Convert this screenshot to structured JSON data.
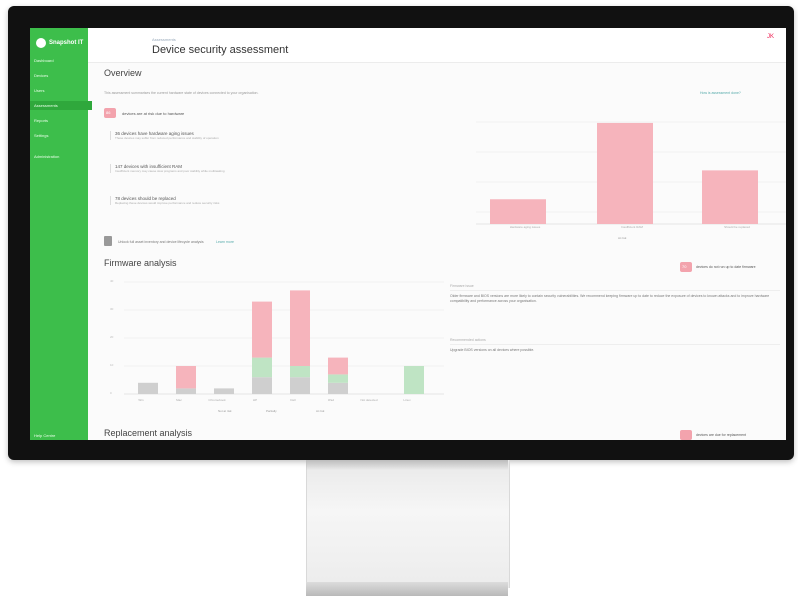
{
  "app": {
    "brand": "Snapshot IT"
  },
  "sidebar": {
    "items": [
      {
        "label": "Dashboard"
      },
      {
        "label": "Devices"
      },
      {
        "label": "Users"
      },
      {
        "label": "Assessments"
      },
      {
        "label": "Reports"
      },
      {
        "label": "Settings"
      },
      {
        "label": "Administration"
      }
    ],
    "footer": "Help Centre"
  },
  "header": {
    "breadcrumb": "Assessments",
    "title": "Device security assessment",
    "user": "JK"
  },
  "overview": {
    "heading": "Overview",
    "intro": "This assessment summarises the current hardware state of devices connected to your organisation.",
    "right_link": "How is assessment done?",
    "badge_value": "86",
    "badge_text": "devices are at risk due to hardware",
    "issues": [
      {
        "title": "36 devices have hardware aging issues",
        "desc": "These devices may suffer from reduced performance and stability of operation"
      },
      {
        "title": "147 devices with insufficient RAM",
        "desc": "Insufficient memory may cause slow programs and poor stability while multitasking"
      },
      {
        "title": "78 devices should be replaced",
        "desc": "Replacing these devices would improve performance and reduce security risks"
      }
    ],
    "footer_text": "Unlock full asset inventory and device lifecycle analysis",
    "footer_link": "Learn more",
    "chart_yticks": [
      "",
      "",
      "",
      "",
      ""
    ],
    "chart_xlabels": [
      "Hardware aging issues",
      "Insufficient RAM",
      "Should be replaced"
    ],
    "chart_legend": "At risk",
    "chart_colors": {
      "risk": "#f6b4bc",
      "ok": "#bfe4c4",
      "neutral": "#cfcfcf"
    }
  },
  "chart_data": [
    {
      "type": "bar",
      "categories": [
        "Hardware aging issues",
        "Insufficient RAM",
        "Should be replaced"
      ],
      "values": [
        36,
        147,
        78
      ],
      "title": "",
      "xlabel": "",
      "ylabel": ""
    },
    {
      "type": "bar",
      "categories": [
        "Win",
        "Mac",
        "Chromebook",
        "HP",
        "Dell",
        "iPad",
        "Not detected",
        "Linux"
      ],
      "series": [
        {
          "name": "At risk",
          "values": [
            0,
            8,
            0,
            20,
            27,
            6,
            0,
            0
          ]
        },
        {
          "name": "Partially",
          "values": [
            0,
            0,
            0,
            7,
            4,
            3,
            0,
            10
          ]
        },
        {
          "name": "Not at risk",
          "values": [
            4,
            2,
            2,
            6,
            6,
            4,
            0,
            0
          ]
        }
      ],
      "ylim": [
        0,
        40
      ]
    }
  ],
  "firmware": {
    "heading": "Firmware analysis",
    "badge_value": "70",
    "badge_text": "devices do not run up to date firmware",
    "yticks": [
      "40",
      "30",
      "20",
      "10",
      "0"
    ],
    "xlabels": [
      "Win",
      "Mac",
      "Chromebook",
      "HP",
      "Dell",
      "iPad",
      "Not detected",
      "Linux"
    ],
    "legend": [
      "Not at risk",
      "Partially",
      "At risk"
    ],
    "side_title": "Firmware issue",
    "side_text": "Older firmware and BIOS versions are more likely to contain security vulnerabilities. We recommend keeping firmware up to date to reduce the exposure of devices to known attacks and to improve hardware compatibility and performance across your organisation.",
    "side_subtitle": "Recommended actions",
    "side_action": "Upgrade BIOS versions on all devices where possible."
  },
  "replacement": {
    "heading": "Replacement analysis",
    "badge_text": "devices are due for replacement"
  }
}
